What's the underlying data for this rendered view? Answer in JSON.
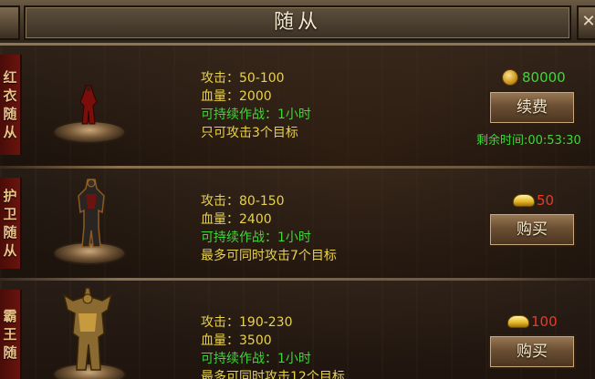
{
  "window": {
    "title": "随从",
    "close_symbol": "✕"
  },
  "followers": [
    {
      "name_chars": [
        "红",
        "衣",
        "随",
        "从"
      ],
      "stats": {
        "attack": "攻击：50-100",
        "hp": "血量：2000",
        "duration": "可持续作战：1小时",
        "targets": "只可攻击3个目标"
      },
      "price": "80000",
      "currency_icon": "coin-icon",
      "button_label": "续费",
      "remaining_time": "剩余时间:00:53:30"
    },
    {
      "name_chars": [
        "护",
        "卫",
        "随",
        "从"
      ],
      "stats": {
        "attack": "攻击：80-150",
        "hp": "血量：2400",
        "duration": "可持续作战：1小时",
        "targets": "最多可同时攻击7个目标"
      },
      "price": "50",
      "currency_icon": "ingot-icon",
      "button_label": "购买"
    },
    {
      "name_chars": [
        "霸",
        "王",
        "随"
      ],
      "stats": {
        "attack": "攻击：190-230",
        "hp": "血量：3500",
        "duration": "可持续作战：1小时",
        "targets": "最多可同时攻击12个目标"
      },
      "price": "100",
      "currency_icon": "ingot-icon",
      "button_label": "购买"
    }
  ],
  "colors": {
    "stat_yellow": "#e8d24a",
    "stat_green": "#3fd63a",
    "price_red": "#e83a2a",
    "banner_red": "#6a140e"
  }
}
